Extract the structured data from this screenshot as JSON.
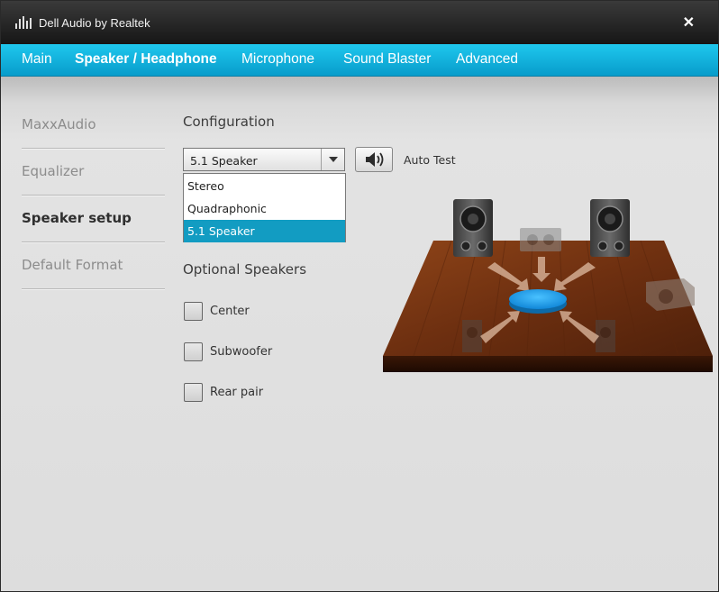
{
  "window": {
    "title": "Dell Audio by Realtek",
    "close_label": "✕"
  },
  "tabs": [
    {
      "label": "Main"
    },
    {
      "label": "Speaker / Headphone"
    },
    {
      "label": "Microphone"
    },
    {
      "label": "Sound Blaster"
    },
    {
      "label": "Advanced"
    }
  ],
  "sidebar": {
    "items": [
      {
        "label": "MaxxAudio"
      },
      {
        "label": "Equalizer"
      },
      {
        "label": "Speaker setup"
      },
      {
        "label": "Default Format"
      }
    ]
  },
  "configuration": {
    "title": "Configuration",
    "selected": "5.1 Speaker",
    "options": [
      "Stereo",
      "Quadraphonic",
      "5.1 Speaker"
    ],
    "auto_test_label": "Auto Test"
  },
  "optional": {
    "title": "Optional Speakers",
    "items": [
      {
        "label": "Center",
        "checked": false
      },
      {
        "label": "Subwoofer",
        "checked": false
      },
      {
        "label": "Rear pair",
        "checked": false
      }
    ]
  },
  "colors": {
    "accent": "#0aa9d9",
    "selection": "#129cc2",
    "floor": "#7a3714",
    "listener": "#1aa3ea"
  },
  "icons": {
    "app": "equalizer-icon",
    "test": "speaker-volume-icon"
  }
}
